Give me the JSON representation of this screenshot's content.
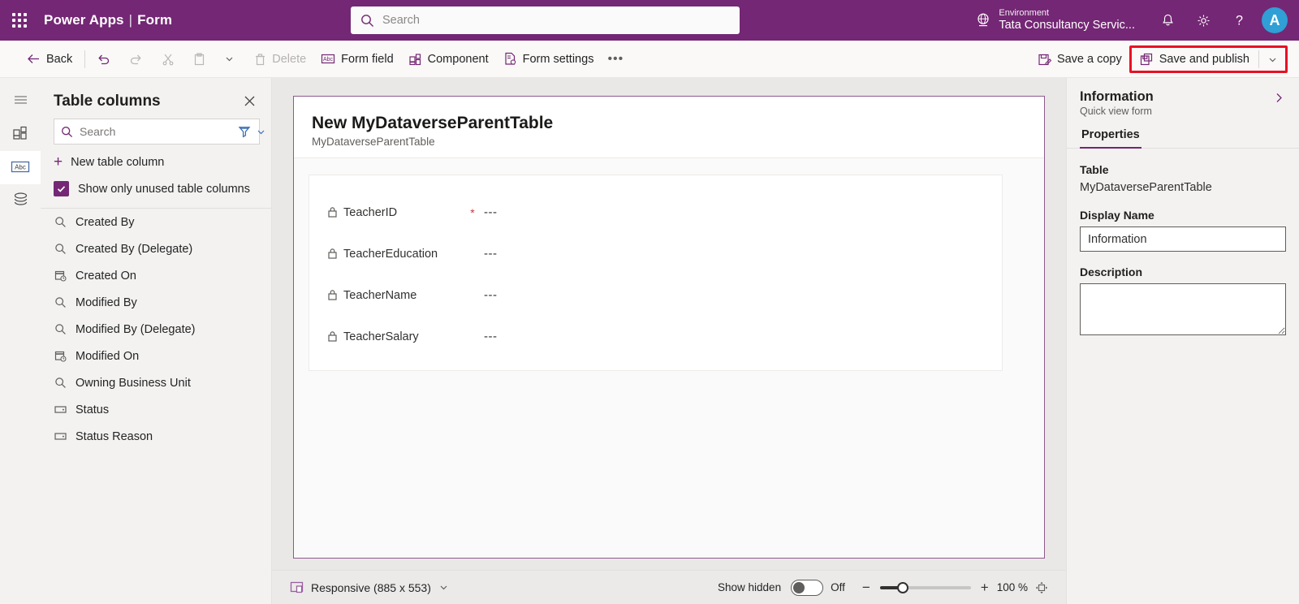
{
  "header": {
    "waffle": "app-launcher",
    "brand_app": "Power Apps",
    "brand_sep": "|",
    "brand_section": "Form",
    "search_placeholder": "Search",
    "environment_label": "Environment",
    "environment_value": "Tata Consultancy Servic...",
    "notifications_icon": "bell-icon",
    "settings_icon": "gear-icon",
    "help_icon": "question-icon",
    "avatar_initial": "A",
    "brand_color": "#742774",
    "avatar_color": "#2f9fd6"
  },
  "commandbar": {
    "back": "Back",
    "undo_icon": "undo-icon",
    "redo_icon": "redo-icon",
    "cut_icon": "scissors-icon",
    "paste_icon": "clipboard-icon",
    "paste_chevron_icon": "chevron-down-icon",
    "delete": "Delete",
    "form_field": "Form field",
    "component": "Component",
    "form_settings": "Form settings",
    "overflow": "•••",
    "save_a_copy": "Save a copy",
    "save_and_publish": "Save and publish",
    "save_chevron_icon": "chevron-down-icon",
    "highlight_color": "#e81123"
  },
  "rail": {
    "items": [
      {
        "name": "menu",
        "icon": "hamburger-icon",
        "selected": false
      },
      {
        "name": "components",
        "icon": "components-grid-icon",
        "selected": false
      },
      {
        "name": "table-columns",
        "icon": "abc-icon",
        "selected": true
      },
      {
        "name": "tree-view",
        "icon": "layers-icon",
        "selected": false
      }
    ]
  },
  "left_panel": {
    "title": "Table columns",
    "close_icon": "close-icon",
    "search_placeholder": "Search",
    "search_value": "",
    "filter_icon": "filter-funnel-icon",
    "filter_chevron_icon": "chevron-down-icon",
    "new_column": "New table column",
    "show_unused_label": "Show only unused table columns",
    "show_unused_checked": true,
    "columns": [
      {
        "label": "Created By",
        "icon": "lookup-icon"
      },
      {
        "label": "Created By (Delegate)",
        "icon": "lookup-icon"
      },
      {
        "label": "Created On",
        "icon": "date-time-icon"
      },
      {
        "label": "Modified By",
        "icon": "lookup-icon"
      },
      {
        "label": "Modified By (Delegate)",
        "icon": "lookup-icon"
      },
      {
        "label": "Modified On",
        "icon": "date-time-icon"
      },
      {
        "label": "Owning Business Unit",
        "icon": "lookup-icon"
      },
      {
        "label": "Status",
        "icon": "choice-icon"
      },
      {
        "label": "Status Reason",
        "icon": "choice-icon"
      }
    ]
  },
  "canvas": {
    "form_title": "New MyDataverseParentTable",
    "form_subtitle": "MyDataverseParentTable",
    "fields": [
      {
        "label": "TeacherID",
        "icon": "lock-icon",
        "required": "*",
        "value": "---"
      },
      {
        "label": "TeacherEducation",
        "icon": "lock-icon",
        "required": "",
        "value": "---"
      },
      {
        "label": "TeacherName",
        "icon": "lock-icon",
        "required": "",
        "value": "---"
      },
      {
        "label": "TeacherSalary",
        "icon": "lock-icon",
        "required": "",
        "value": "---"
      }
    ]
  },
  "statusbar": {
    "device_icon": "responsive-device-icon",
    "device_label": "Responsive (885 x 553)",
    "device_chevron_icon": "chevron-down-icon",
    "show_hidden_label": "Show hidden",
    "show_hidden_state": "Off",
    "zoom_out_icon": "minus-icon",
    "zoom_in_icon": "plus-icon",
    "zoom_value": "100 %",
    "fit_icon": "fit-to-screen-icon"
  },
  "right_panel": {
    "title": "Information",
    "subtitle": "Quick view form",
    "collapse_icon": "chevron-right-icon",
    "tab_properties": "Properties",
    "table_label": "Table",
    "table_value": "MyDataverseParentTable",
    "display_name_label": "Display Name",
    "display_name_value": "Information",
    "description_label": "Description",
    "description_value": ""
  }
}
